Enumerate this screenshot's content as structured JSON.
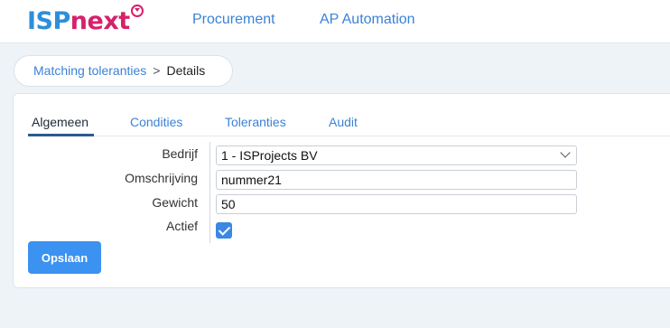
{
  "header": {
    "logo_part1": "ISP",
    "logo_part2": "next",
    "nav": [
      "Procurement",
      "AP Automation"
    ]
  },
  "breadcrumb": {
    "parent": "Matching toleranties",
    "separator": ">",
    "current": "Details"
  },
  "tabs": [
    {
      "label": "Algemeen",
      "active": true
    },
    {
      "label": "Condities",
      "active": false
    },
    {
      "label": "Toleranties",
      "active": false
    },
    {
      "label": "Audit",
      "active": false
    }
  ],
  "form": {
    "bedrijf": {
      "label": "Bedrijf",
      "value": "1 - ISProjects BV"
    },
    "omschrijving": {
      "label": "Omschrijving",
      "value": "nummer21"
    },
    "gewicht": {
      "label": "Gewicht",
      "value": "50"
    },
    "actief": {
      "label": "Actief",
      "checked": true
    }
  },
  "actions": {
    "save_label": "Opslaan"
  },
  "colors": {
    "brand_blue": "#2d8fd9",
    "brand_pink": "#d6216b",
    "button": "#3b92f0"
  }
}
